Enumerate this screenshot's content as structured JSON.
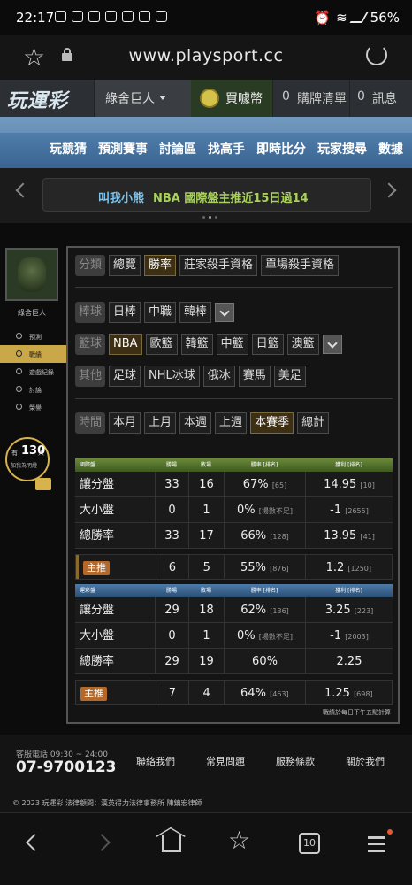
{
  "status": {
    "time": "22:17",
    "battery": "56%"
  },
  "browser": {
    "url": "www.playsport.cc"
  },
  "header": {
    "logo": "玩運彩",
    "user": "綠舍巨人",
    "coin_label": "買噱幣",
    "cart_count": "0",
    "cart_label": "購牌清單",
    "msg_count": "0",
    "msg_label": "訊息"
  },
  "nav": {
    "items": [
      "玩競猜",
      "預測賽事",
      "討論區",
      "找高手",
      "即時比分",
      "玩家搜尋",
      "數據"
    ]
  },
  "announce": {
    "name": "叫我小熊",
    "text": "NBA 國際盤主推近15日過14"
  },
  "sidebar": {
    "username": "綠舍巨人",
    "menu": [
      "預測",
      "戰績",
      "遊戲紀錄",
      "討論",
      "榮譽"
    ],
    "badge": {
      "prefix": "有",
      "count": "130",
      "suffix": "人",
      "line2": "加我為明燈"
    }
  },
  "filters": {
    "category": {
      "key": "分類",
      "options": [
        "總覽",
        "勝率",
        "莊家殺手資格",
        "單場殺手資格"
      ],
      "selected": 1
    },
    "baseball": {
      "key": "棒球",
      "options": [
        "日棒",
        "中職",
        "韓棒"
      ]
    },
    "basketball": {
      "key": "籃球",
      "options": [
        "NBA",
        "歐籃",
        "韓籃",
        "中籃",
        "日籃",
        "澳籃"
      ],
      "selected": 0
    },
    "other": {
      "key": "其他",
      "options": [
        "足球",
        "NHL冰球",
        "俄冰",
        "賽馬",
        "美足"
      ]
    },
    "time": {
      "key": "時間",
      "options": [
        "本月",
        "上月",
        "本週",
        "上週",
        "本賽季",
        "總計"
      ],
      "selected": 4
    }
  },
  "intl_table": {
    "headers": [
      "國際盤",
      "勝場",
      "敗場",
      "勝率 [排名]",
      "獲利 [排名]"
    ],
    "rows": [
      {
        "name": "讓分盤",
        "w": "33",
        "l": "16",
        "pct": "67%",
        "pct_rank": "[65]",
        "profit": "14.95",
        "profit_rank": "[10]"
      },
      {
        "name": "大小盤",
        "w": "0",
        "l": "1",
        "pct": "0%",
        "pct_rank": "[場數不足]",
        "profit": "-1",
        "profit_rank": "[2655]"
      },
      {
        "name": "總勝率",
        "w": "33",
        "l": "17",
        "pct": "66%",
        "pct_rank": "[128]",
        "profit": "13.95",
        "profit_rank": "[41]"
      }
    ],
    "main": {
      "name": "主推",
      "w": "6",
      "l": "5",
      "pct": "55%",
      "pct_rank": "[876]",
      "profit": "1.2",
      "profit_rank": "[1250]"
    }
  },
  "local_table": {
    "headers": [
      "運彩盤",
      "勝場",
      "敗場",
      "勝率 [排名]",
      "獲利 [排名]"
    ],
    "rows": [
      {
        "name": "讓分盤",
        "w": "29",
        "l": "18",
        "pct": "62%",
        "pct_rank": "[136]",
        "profit": "3.25",
        "profit_rank": "[223]"
      },
      {
        "name": "大小盤",
        "w": "0",
        "l": "1",
        "pct": "0%",
        "pct_rank": "[場數不足]",
        "profit": "-1",
        "profit_rank": "[2003]"
      },
      {
        "name": "總勝率",
        "w": "29",
        "l": "19",
        "pct": "60%",
        "pct_rank": "",
        "profit": "2.25",
        "profit_rank": ""
      }
    ],
    "main": {
      "name": "主推",
      "w": "7",
      "l": "4",
      "pct": "64%",
      "pct_rank": "[463]",
      "profit": "1.25",
      "profit_rank": "[698]"
    }
  },
  "note": "戰績於每日下午五點計算",
  "footer": {
    "service": "客服電話 09:30 ~ 24:00",
    "phone": "07-9700123",
    "links": [
      "聯絡我們",
      "常見問題",
      "服務條款",
      "關於我們"
    ],
    "copyright": "© 2023 玩運彩 法律顧問：漢英得力法律事務所 陳鎮宏律師"
  },
  "bottomnav": {
    "tab_count": "10"
  }
}
